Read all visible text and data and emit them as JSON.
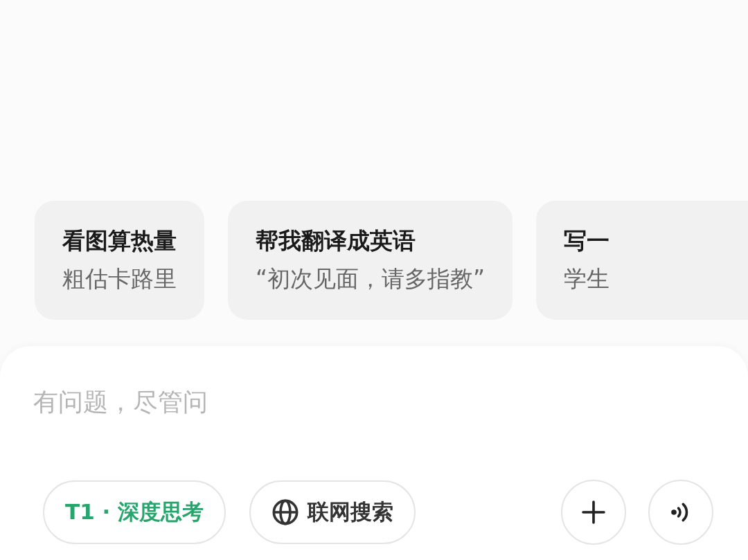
{
  "suggestions": [
    {
      "title": "看图算热量",
      "subtitle": "粗估卡路里"
    },
    {
      "title": "帮我翻译成英语",
      "subtitle": "“初次见面，请多指教”"
    },
    {
      "title": "写一",
      "subtitle": "学生"
    }
  ],
  "composer": {
    "placeholder": "有问题，尽管问",
    "toggles": [
      {
        "kind": "model",
        "label": "T1 · 深度思考",
        "selected": true
      },
      {
        "kind": "web",
        "label": "联网搜索",
        "selected": false
      }
    ],
    "actions": [
      {
        "kind": "add"
      },
      {
        "kind": "voice"
      }
    ]
  }
}
